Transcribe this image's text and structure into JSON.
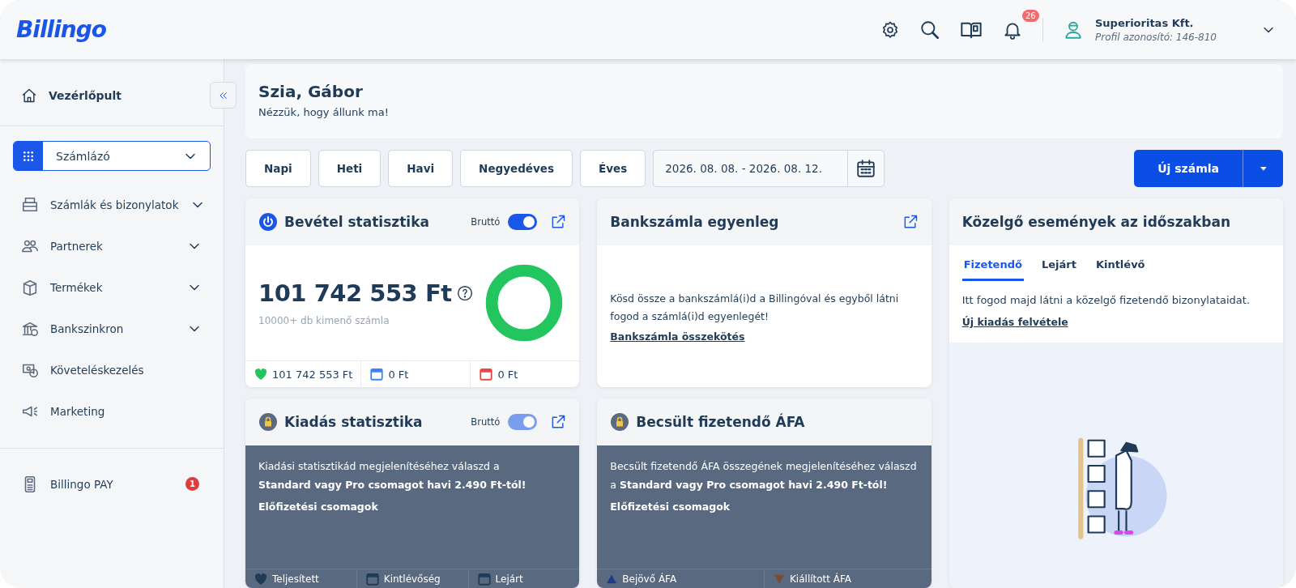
{
  "header": {
    "logo": "Billingo",
    "notifications_badge": "26",
    "company": "Superioritas Kft.",
    "profile_id": "Profil azonosító: 146-810"
  },
  "sidebar": {
    "dashboard": "Vezérlőpult",
    "module_select": "Számlázó",
    "items": [
      {
        "label": "Számlák és bizonylatok",
        "kind": "invoices",
        "expandable": true
      },
      {
        "label": "Partnerek",
        "kind": "partners",
        "expandable": true
      },
      {
        "label": "Termékek",
        "kind": "products",
        "expandable": true
      },
      {
        "label": "Bankszinkron",
        "kind": "bank",
        "expandable": true
      },
      {
        "label": "Követeléskezelés",
        "kind": "claims",
        "expandable": false
      },
      {
        "label": "Marketing",
        "kind": "marketing",
        "expandable": false
      }
    ],
    "bottom_items": [
      {
        "label": "Billingo PAY",
        "kind": "pay",
        "badge": "1"
      }
    ]
  },
  "greeting": {
    "title": "Szia, Gábor",
    "subtitle": "Nézzük, hogy állunk ma!"
  },
  "periods": [
    "Napi",
    "Heti",
    "Havi",
    "Negyedéves",
    "Éves"
  ],
  "date_range": {
    "value": "2026. 08. 08. - 2026. 08. 12."
  },
  "new_invoice_button": "Új számla",
  "cards": [
    {
      "kind": "revenue",
      "title": "Bevétel statisztika",
      "toggle": {
        "label": "Bruttó",
        "on": true,
        "disabled": false
      },
      "amount": "101 742 553 Ft",
      "caption": "10000+ db kimenő számla",
      "stats": [
        {
          "kind": "heart",
          "value": "101 742 553 Ft",
          "color": "#22c55e"
        },
        {
          "kind": "calendar",
          "value": "0 Ft",
          "color": "#3b82f6"
        },
        {
          "kind": "calendar",
          "value": "0 Ft",
          "color": "#ef4444"
        }
      ]
    },
    {
      "kind": "bank",
      "title": "Bankszámla egyenleg",
      "text": "Kösd össze a bankszámlá(i)d a Billingóval és egyből látni fogod a számlá(i)d egyenlegét!",
      "link": "Bankszámla összekötés"
    },
    {
      "kind": "events",
      "title": "Közelgő események az időszakban",
      "tabs": [
        {
          "label": "Fizetendő",
          "selected": true
        },
        {
          "label": "Lejárt",
          "selected": false
        },
        {
          "label": "Kintlévő",
          "selected": false
        }
      ],
      "text": "Itt fogod majd látni a közelgő fizetendő bizonylataidat.",
      "link": "Új kiadás felvétele"
    },
    {
      "kind": "locked",
      "title": "Kiadás statisztika",
      "toggle": {
        "label": "Bruttó",
        "on": true,
        "disabled": true
      },
      "text": "Kiadási statisztikád megjelenítéséhez válaszd a\n**Standard vagy Pro csomagot havi 2.490 Ft-tól!**",
      "link": "Előfizetési csomagok",
      "stats": [
        {
          "kind": "heart",
          "value": "Teljesített",
          "color": "#1f3b57"
        },
        {
          "kind": "calendar",
          "value": "Kintlévőség",
          "color": "#1f3b57"
        },
        {
          "kind": "calendar",
          "value": "Lejárt",
          "color": "#1f3b57"
        }
      ]
    },
    {
      "kind": "locked",
      "title": "Becsült fizetendő ÁFA",
      "text": "Becsült fizetendő ÁFA összegének megjelenítéséhez válaszd\na **Standard vagy Pro csomagot havi 2.490 Ft-tól!**",
      "link": "Előfizetési csomagok",
      "stats": [
        {
          "kind": "up",
          "value": "Bejövő ÁFA",
          "color": "#1e3a8a"
        },
        {
          "kind": "down",
          "value": "Kiállított ÁFA",
          "color": "#7c4a2d"
        }
      ]
    }
  ]
}
